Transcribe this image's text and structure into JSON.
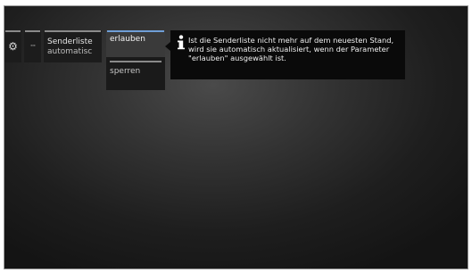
{
  "menu": {
    "settings_icon": "gear-icon",
    "ellipsis_label": "···",
    "channel_list": {
      "title": "Senderliste",
      "value": "automatisc"
    }
  },
  "dropdown": {
    "options": [
      {
        "label": "erlauben",
        "selected": true
      },
      {
        "label": "sperren",
        "selected": false
      }
    ]
  },
  "info": {
    "icon": "info-icon",
    "text": "Ist die Senderliste nicht mehr auf dem neuesten Stand, wird sie automatisch aktualisiert, wenn der Parameter \"erlauben\" ausgewählt ist."
  },
  "colors": {
    "accent": "#6f9ed6",
    "panel": "#1c1c1c",
    "info_background": "#0a0a0a"
  }
}
